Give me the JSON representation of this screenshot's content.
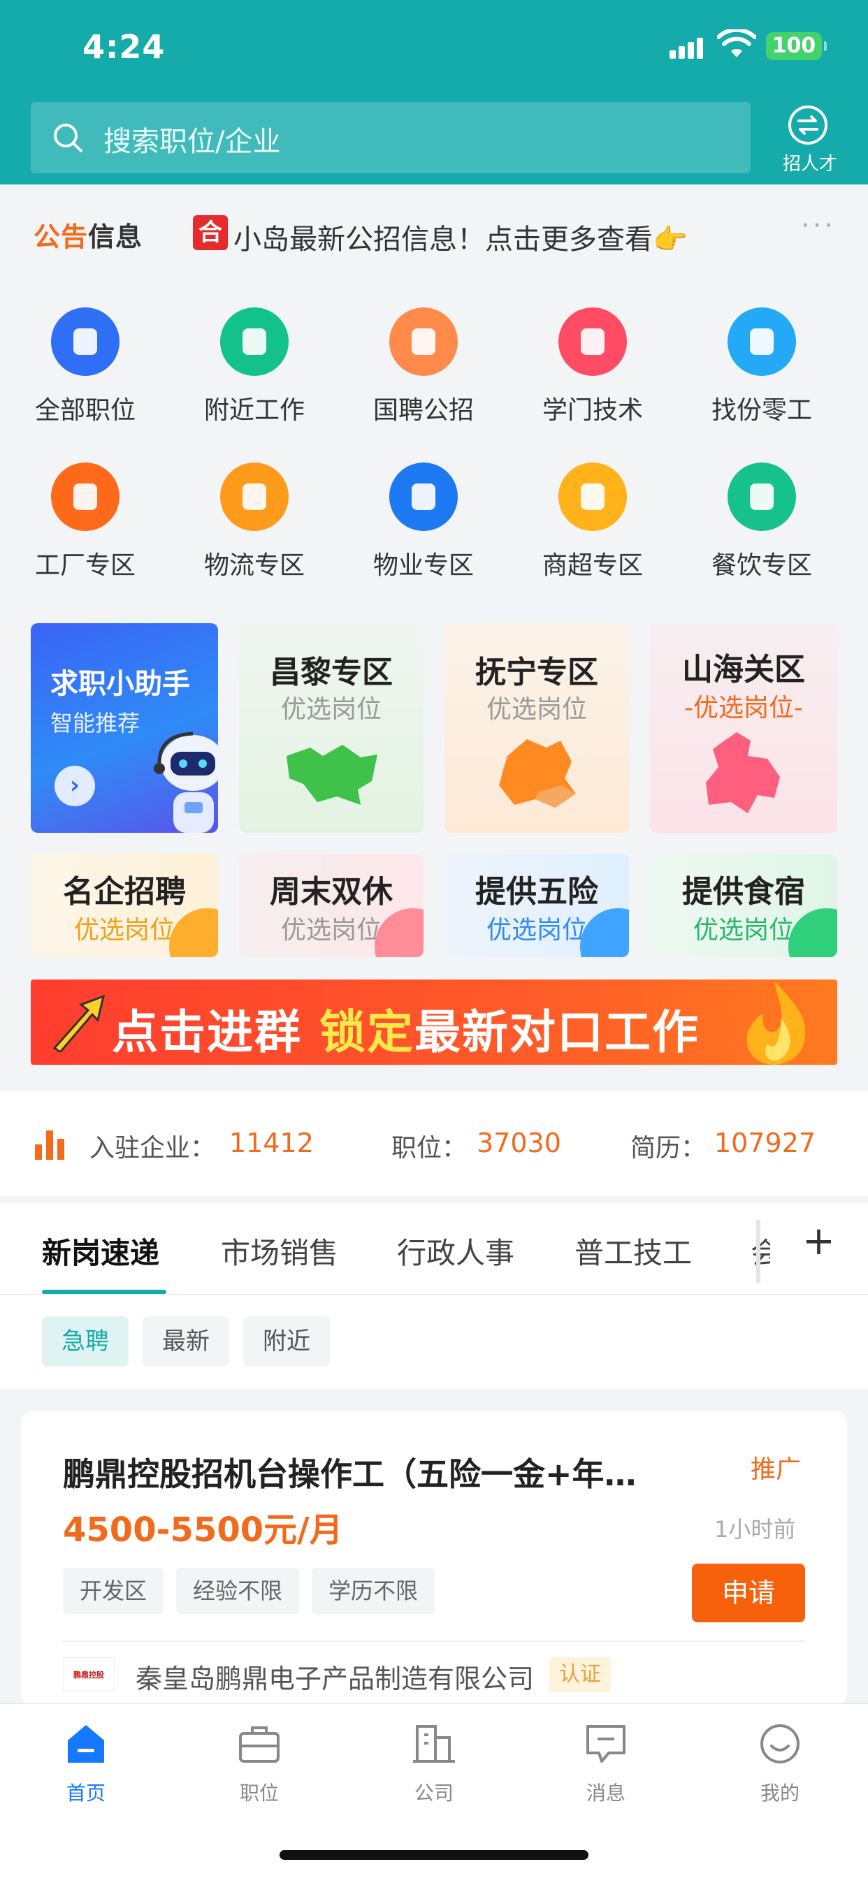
{
  "status_bar": {
    "time": "4:24",
    "battery": "100"
  },
  "search": {
    "placeholder": "搜索职位/企业"
  },
  "recruit_button": {
    "label": "招人才"
  },
  "notice": {
    "brand_part1": "公告",
    "brand_part2": "信息",
    "badge": "合",
    "text": "小岛最新公招信息！点击更多查看👉",
    "more": "···"
  },
  "categories": [
    {
      "label": "全部职位",
      "icon": "tie-icon",
      "color": "#2f6ff5"
    },
    {
      "label": "附近工作",
      "icon": "location-pin-icon",
      "color": "#12c28a"
    },
    {
      "label": "国聘公招",
      "icon": "megaphone-icon",
      "color": "#ff8a4a"
    },
    {
      "label": "学门技术",
      "icon": "toolbox-icon",
      "color": "#ff4b63"
    },
    {
      "label": "找份零工",
      "icon": "compass-icon",
      "color": "#23a9f5"
    },
    {
      "label": "工厂专区",
      "icon": "document-icon",
      "color": "#ff6a1a"
    },
    {
      "label": "物流专区",
      "icon": "package-icon",
      "color": "#ff9b1a"
    },
    {
      "label": "物业专区",
      "icon": "house-icon",
      "color": "#1d79f2"
    },
    {
      "label": "商超专区",
      "icon": "calendar-check-icon",
      "color": "#ffb21a"
    },
    {
      "label": "餐饮专区",
      "icon": "bell-icon",
      "color": "#16c18a"
    }
  ],
  "assistant_card": {
    "title": "求职小助手",
    "subtitle": "智能推荐"
  },
  "region_cards": [
    {
      "title": "昌黎专区",
      "subtitle": "优选岗位"
    },
    {
      "title": "抚宁专区",
      "subtitle": "优选岗位"
    },
    {
      "title": "山海关区",
      "subtitle": "-优选岗位-"
    }
  ],
  "feature_cards": [
    {
      "title": "名企招聘",
      "subtitle": "优选岗位"
    },
    {
      "title": "周末双休",
      "subtitle": "优选岗位"
    },
    {
      "title": "提供五险",
      "subtitle": "优选岗位"
    },
    {
      "title": "提供食宿",
      "subtitle": "优选岗位"
    }
  ],
  "banner": {
    "text_part1": "点击进群 ",
    "text_part2": "锁定",
    "text_part3": "最新对口工作"
  },
  "stats": {
    "companies_label": "入驻企业：",
    "companies_value": "11412",
    "jobs_label": "职位：",
    "jobs_value": "37030",
    "resumes_label": "简历：",
    "resumes_value": "107927"
  },
  "tabs": [
    "新岗速递",
    "市场销售",
    "行政人事",
    "普工技工",
    "会"
  ],
  "tab_plus": "+",
  "filters": [
    "急聘",
    "最新",
    "附近"
  ],
  "job": {
    "title": "鹏鼎控股招机台操作工（五险一金+年…",
    "promo": "推广",
    "salary": "4500-5500元/月",
    "time": "1小时前",
    "tags": [
      "开发区",
      "经验不限",
      "学历不限"
    ],
    "apply": "申请",
    "company": "秦皇岛鹏鼎电子产品制造有限公司",
    "verified": "认证",
    "logo_text": "鹏鼎控股"
  },
  "nav": [
    {
      "label": "首页",
      "icon": "home-icon"
    },
    {
      "label": "职位",
      "icon": "briefcase-icon"
    },
    {
      "label": "公司",
      "icon": "building-icon"
    },
    {
      "label": "消息",
      "icon": "message-icon"
    },
    {
      "label": "我的",
      "icon": "smiley-icon"
    }
  ]
}
